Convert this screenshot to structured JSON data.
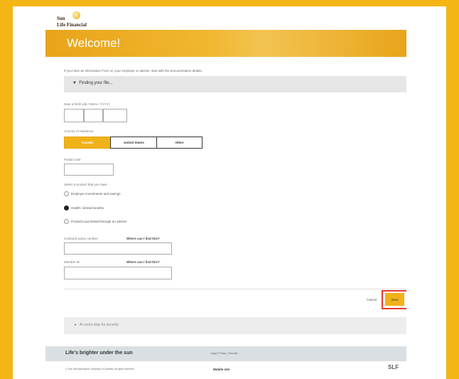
{
  "logo": {
    "line1": "Sun",
    "line2": "Life Financial"
  },
  "banner": {
    "title": "Welcome!"
  },
  "intro": "If you have an Information Form or, your employer or adviser, start with the documentation details.",
  "finding_section": {
    "label": "Finding your file..."
  },
  "dob": {
    "label": "Date of birth (dd / Mmm / YYYY)"
  },
  "country": {
    "label": "Country of residence",
    "options": [
      "Canada",
      "United States",
      "Other"
    ],
    "selected": "Canada"
  },
  "postal": {
    "label": "Postal code"
  },
  "plans": {
    "label": "Select a product that you have",
    "options": [
      {
        "label": "Employer investments and savings",
        "selected": false
      },
      {
        "label": "Health / dental benefits",
        "selected": true
      },
      {
        "label": "Products purchased through an adviser",
        "selected": false
      }
    ]
  },
  "contract": {
    "label": "Contract/ policy number",
    "help": "Where can I find this?"
  },
  "member": {
    "label": "Member ID",
    "help": "Where can I find this?"
  },
  "actions": {
    "cancel": "Cancel",
    "next": "Next"
  },
  "security_section": {
    "label": "An extra step for security"
  },
  "footer": {
    "tagline": "Life's brighter under the sun",
    "links": "Legal   |   Privacy   |   Security",
    "copyright": "© Sun Life Assurance Company of Canada. All rights reserved.",
    "mobile": "Mobile site",
    "brand": "SLF"
  },
  "colors": {
    "accent": "#f4b615",
    "highlight": "#e43b2a",
    "button": "#f0b21a"
  }
}
